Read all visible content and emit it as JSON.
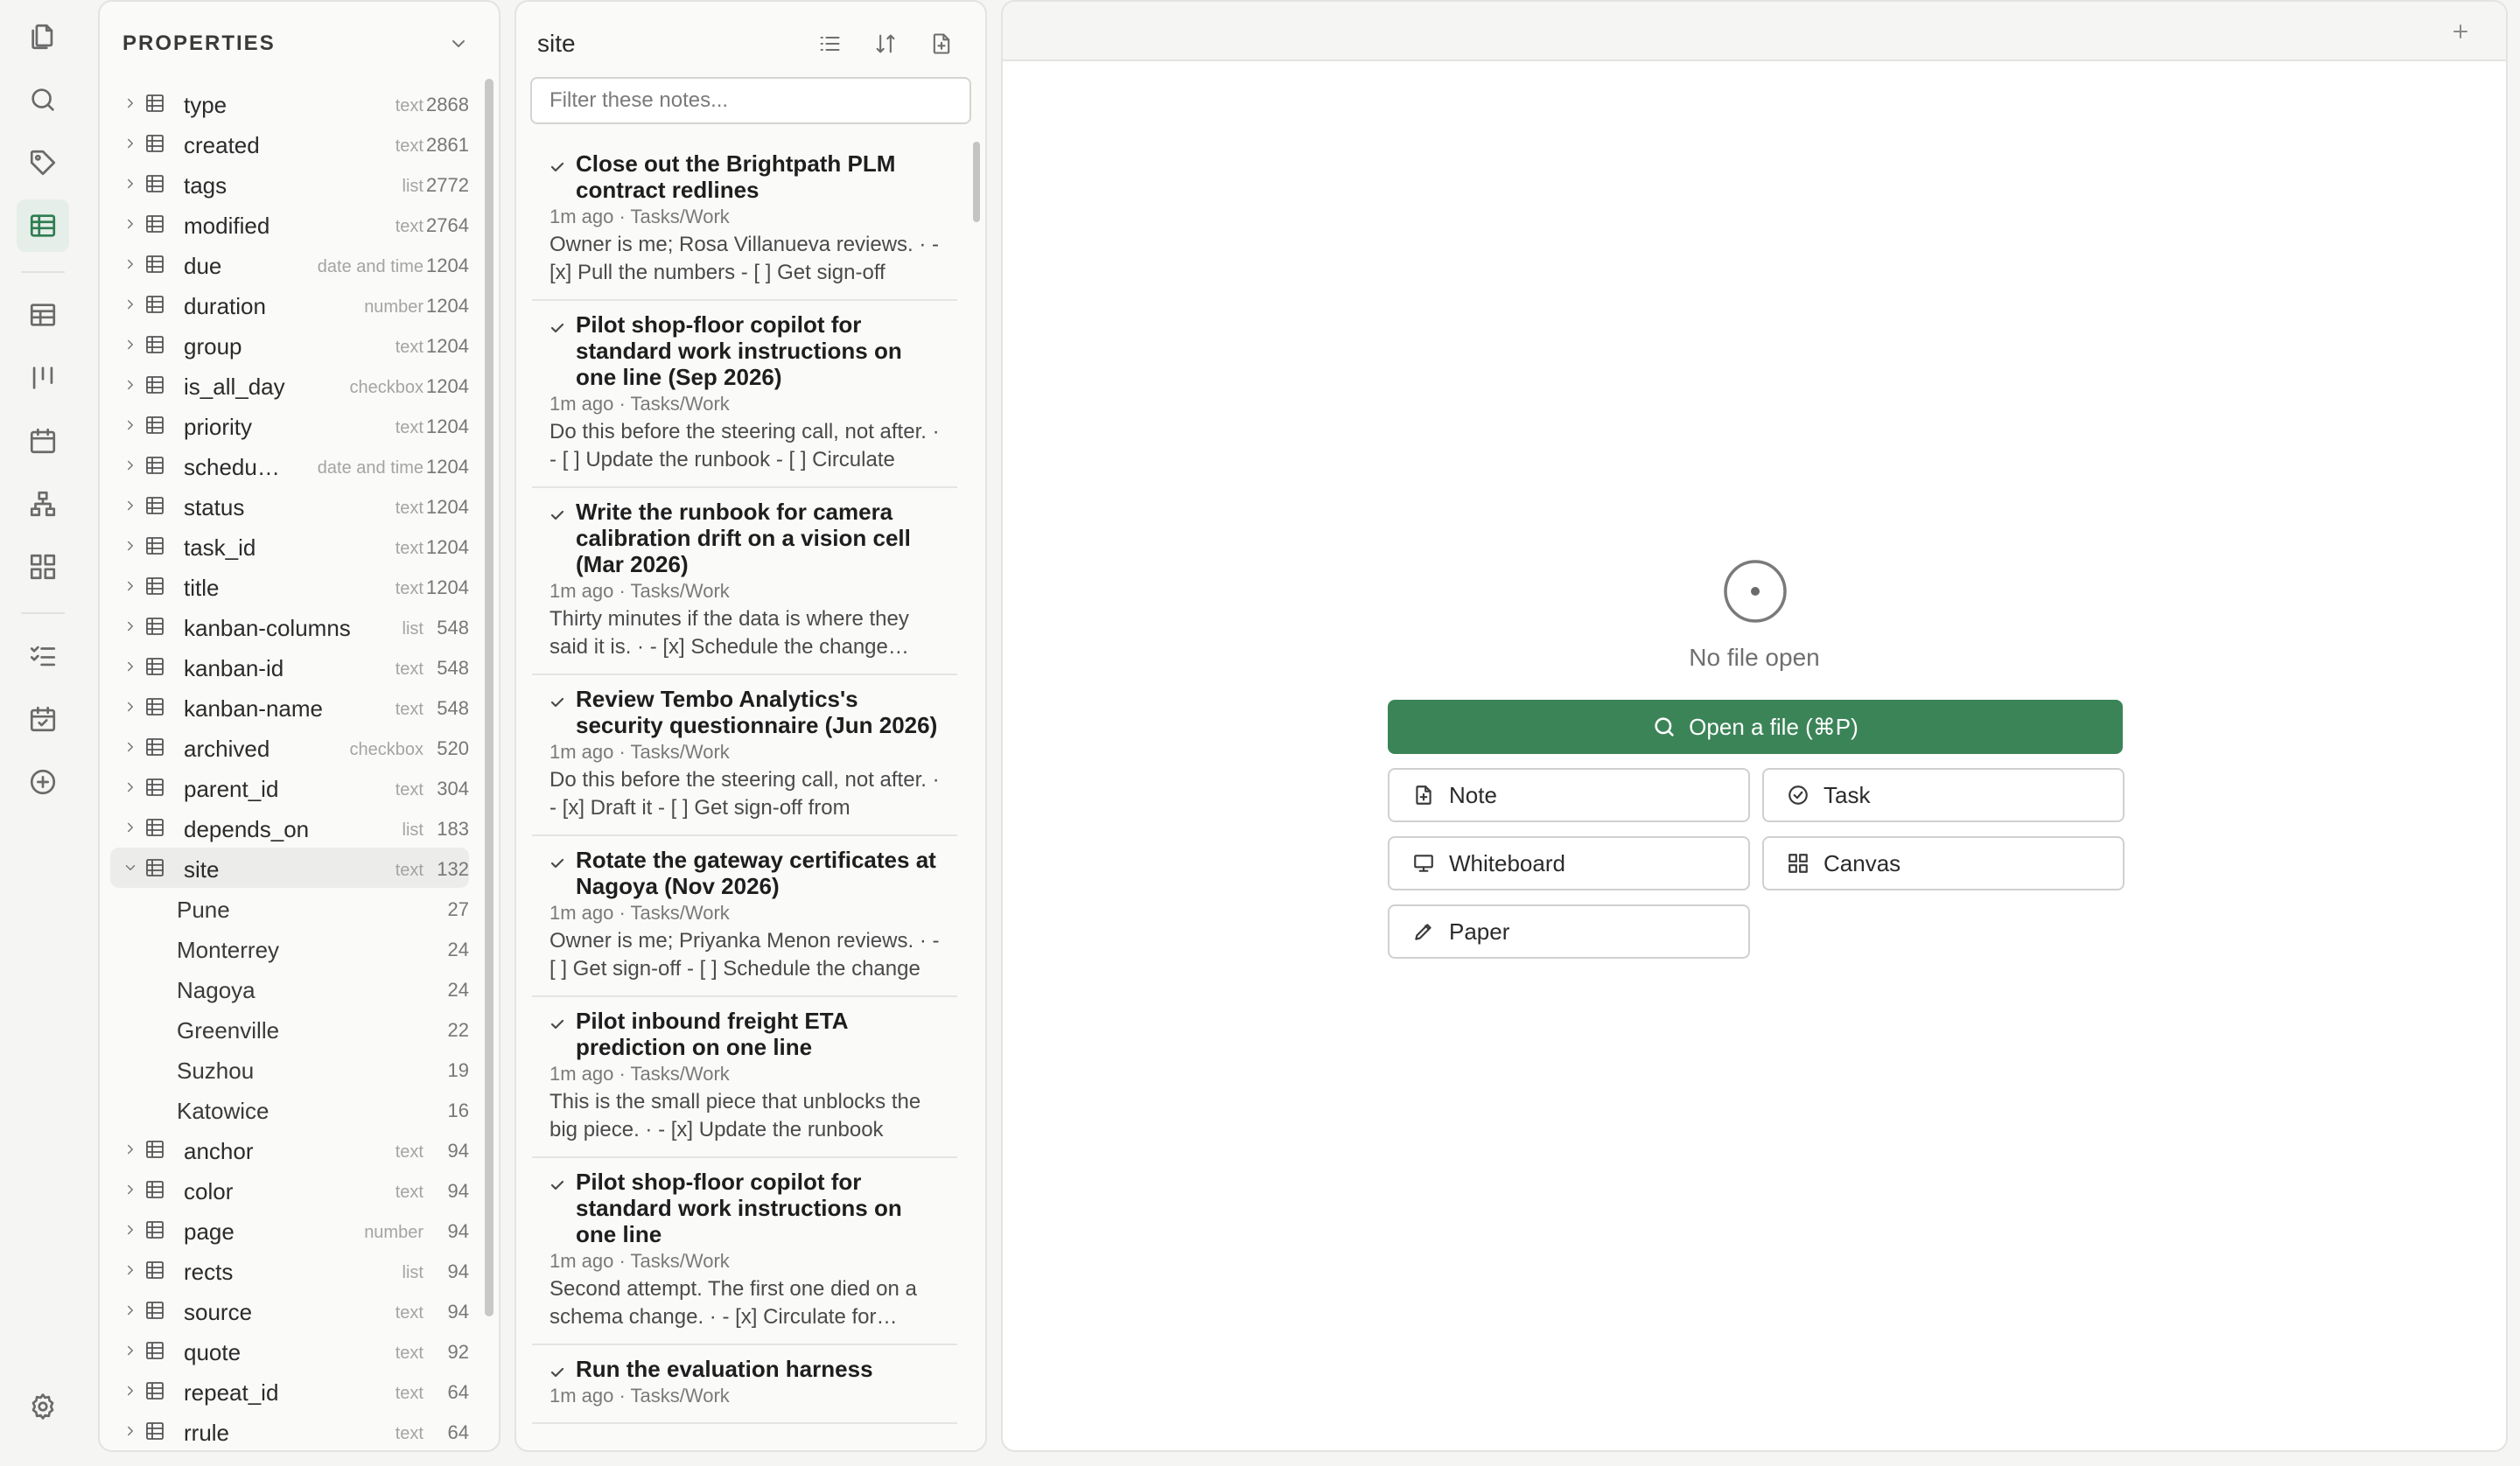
{
  "ribbon": {
    "items": [
      "files-icon",
      "search-icon",
      "tag-icon",
      "table-icon",
      "database-icon",
      "kanban-icon",
      "calendar-icon",
      "graph-icon",
      "dashboard-icon",
      "tasks-icon",
      "calendar-check-icon",
      "add-icon"
    ],
    "settings": "gear-icon"
  },
  "properties": {
    "title": "PROPERTIES",
    "items": [
      {
        "name": "type",
        "type": "text",
        "count": "2868"
      },
      {
        "name": "created",
        "type": "text",
        "count": "2861"
      },
      {
        "name": "tags",
        "type": "list",
        "count": "2772"
      },
      {
        "name": "modified",
        "type": "text",
        "count": "2764"
      },
      {
        "name": "due",
        "type": "date and time",
        "count": "1204"
      },
      {
        "name": "duration",
        "type": "number",
        "count": "1204"
      },
      {
        "name": "group",
        "type": "text",
        "count": "1204"
      },
      {
        "name": "is_all_day",
        "type": "checkbox",
        "count": "1204"
      },
      {
        "name": "priority",
        "type": "text",
        "count": "1204"
      },
      {
        "name": "schedu…",
        "type": "date and time",
        "count": "1204"
      },
      {
        "name": "status",
        "type": "text",
        "count": "1204"
      },
      {
        "name": "task_id",
        "type": "text",
        "count": "1204"
      },
      {
        "name": "title",
        "type": "text",
        "count": "1204"
      },
      {
        "name": "kanban-columns",
        "type": "list",
        "count": "548"
      },
      {
        "name": "kanban-id",
        "type": "text",
        "count": "548"
      },
      {
        "name": "kanban-name",
        "type": "text",
        "count": "548"
      },
      {
        "name": "archived",
        "type": "checkbox",
        "count": "520"
      },
      {
        "name": "parent_id",
        "type": "text",
        "count": "304"
      },
      {
        "name": "depends_on",
        "type": "list",
        "count": "183"
      },
      {
        "name": "site",
        "type": "text",
        "count": "132",
        "expanded": true,
        "values": [
          {
            "name": "Pune",
            "count": "27"
          },
          {
            "name": "Monterrey",
            "count": "24"
          },
          {
            "name": "Nagoya",
            "count": "24"
          },
          {
            "name": "Greenville",
            "count": "22"
          },
          {
            "name": "Suzhou",
            "count": "19"
          },
          {
            "name": "Katowice",
            "count": "16"
          }
        ]
      },
      {
        "name": "anchor",
        "type": "text",
        "count": "94"
      },
      {
        "name": "color",
        "type": "text",
        "count": "94"
      },
      {
        "name": "page",
        "type": "number",
        "count": "94"
      },
      {
        "name": "rects",
        "type": "list",
        "count": "94"
      },
      {
        "name": "source",
        "type": "text",
        "count": "94"
      },
      {
        "name": "quote",
        "type": "text",
        "count": "92"
      },
      {
        "name": "repeat_id",
        "type": "text",
        "count": "64"
      },
      {
        "name": "rrule",
        "type": "text",
        "count": "64"
      }
    ]
  },
  "notes": {
    "title": "site",
    "filter_placeholder": "Filter these notes...",
    "items": [
      {
        "title": "Close out the Brightpath PLM contract redlines",
        "meta": "1m ago · Tasks/Work",
        "preview": "Owner is me; Rosa Villanueva reviews. · - [x] Pull the numbers - [ ] Get sign-off"
      },
      {
        "title": "Pilot shop-floor copilot for standard work instructions on one line (Sep 2026)",
        "meta": "1m ago · Tasks/Work",
        "preview": "Do this before the steering call, not after. · - [ ] Update the runbook - [ ] Circulate"
      },
      {
        "title": "Write the runbook for camera calibration drift on a vision cell (Mar 2026)",
        "meta": "1m ago · Tasks/Work",
        "preview": "Thirty minutes if the data is where they said it is. · - [x] Schedule the change window"
      },
      {
        "title": "Review Tembo Analytics's security questionnaire (Jun 2026)",
        "meta": "1m ago · Tasks/Work",
        "preview": "Do this before the steering call, not after. · - [x] Draft it - [ ] Get sign-off from"
      },
      {
        "title": "Rotate the gateway certificates at Nagoya (Nov 2026)",
        "meta": "1m ago · Tasks/Work",
        "preview": "Owner is me; Priyanka Menon reviews. · - [ ] Get sign-off - [ ] Schedule the change"
      },
      {
        "title": "Pilot inbound freight ETA prediction on one line",
        "meta": "1m ago · Tasks/Work",
        "preview": "This is the small piece that unblocks the big piece. · - [x] Update the runbook"
      },
      {
        "title": "Pilot shop-floor copilot for standard work instructions on one line",
        "meta": "1m ago · Tasks/Work",
        "preview": "Second attempt. The first one died on a schema change. · - [x] Circulate for review"
      },
      {
        "title": "Run the evaluation harness",
        "meta": "1m ago · Tasks/Work",
        "preview": ""
      }
    ]
  },
  "main": {
    "empty_title": "No file open",
    "open_label": "Open a file (⌘P)",
    "buttons": {
      "note": "Note",
      "task": "Task",
      "whiteboard": "Whiteboard",
      "canvas": "Canvas",
      "paper": "Paper"
    }
  },
  "colors": {
    "accent": "#3b8458",
    "accent_active_bg": "#e5eee8"
  }
}
